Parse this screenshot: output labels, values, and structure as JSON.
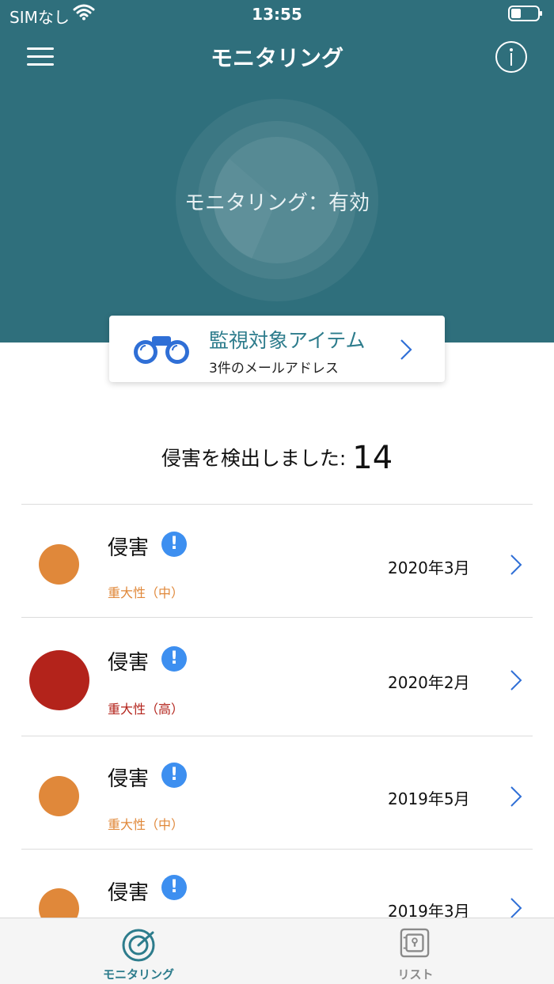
{
  "status_bar": {
    "carrier": "SIMなし",
    "time": "13:55"
  },
  "nav": {
    "title": "モニタリング"
  },
  "radar": {
    "status_text": "モニタリング：有効"
  },
  "monitor_card": {
    "title": "監視対象アイテム",
    "subtitle": "3件のメールアドレス"
  },
  "summary": {
    "label": "侵害を検出しました:",
    "count": "14"
  },
  "breaches": [
    {
      "title": "侵害",
      "severity": "重大性（中）",
      "severity_level": "medium",
      "color": "#e0883a",
      "date": "2020年3月"
    },
    {
      "title": "侵害",
      "severity": "重大性（高）",
      "severity_level": "high",
      "color": "#b3231b",
      "date": "2020年2月"
    },
    {
      "title": "侵害",
      "severity": "重大性（中）",
      "severity_level": "medium",
      "color": "#e0883a",
      "date": "2019年5月"
    },
    {
      "title": "侵害",
      "severity": "",
      "severity_level": "medium",
      "color": "#e0883a",
      "date": "2019年3月"
    }
  ],
  "alert_glyph": "!",
  "tabs": [
    {
      "label": "モニタリング",
      "icon": "radar-icon",
      "active": true
    },
    {
      "label": "リスト",
      "icon": "vault-icon",
      "active": false
    }
  ],
  "colors": {
    "header_bg": "#2f6f7c",
    "accent": "#2d7c8c",
    "medium": "#e0883a",
    "high": "#b3231b",
    "alert_blue": "#3d8ff0"
  }
}
